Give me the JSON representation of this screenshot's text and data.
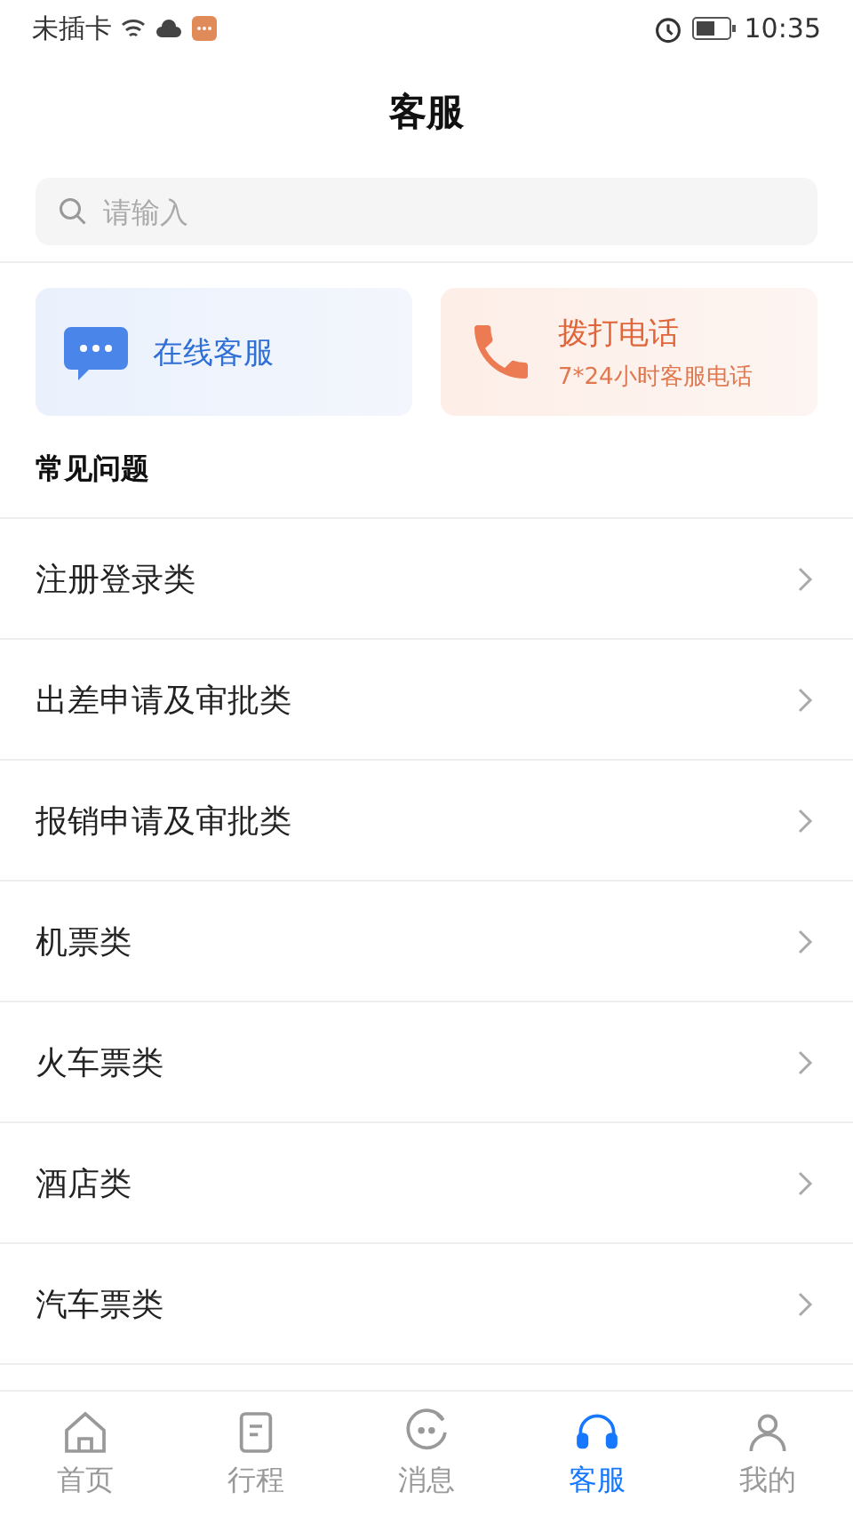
{
  "status_bar": {
    "carrier": "未插卡",
    "time": "10:35"
  },
  "header": {
    "title": "客服"
  },
  "search": {
    "placeholder": "请输入"
  },
  "services": [
    {
      "kind": "chat",
      "title": "在线客服"
    },
    {
      "kind": "phone",
      "title": "拨打电话",
      "subtitle": "7*24小时客服电话"
    }
  ],
  "faq": {
    "title": "常见问题",
    "items": [
      "注册登录类",
      "出差申请及审批类",
      "报销申请及审批类",
      "机票类",
      "火车票类",
      "酒店类",
      "汽车票类"
    ]
  },
  "tabs": [
    {
      "kind": "home",
      "label": "首页",
      "selected": false
    },
    {
      "kind": "trip",
      "label": "行程",
      "selected": false
    },
    {
      "kind": "message",
      "label": "消息",
      "selected": false
    },
    {
      "kind": "service",
      "label": "客服",
      "selected": true
    },
    {
      "kind": "me",
      "label": "我的",
      "selected": false
    }
  ]
}
